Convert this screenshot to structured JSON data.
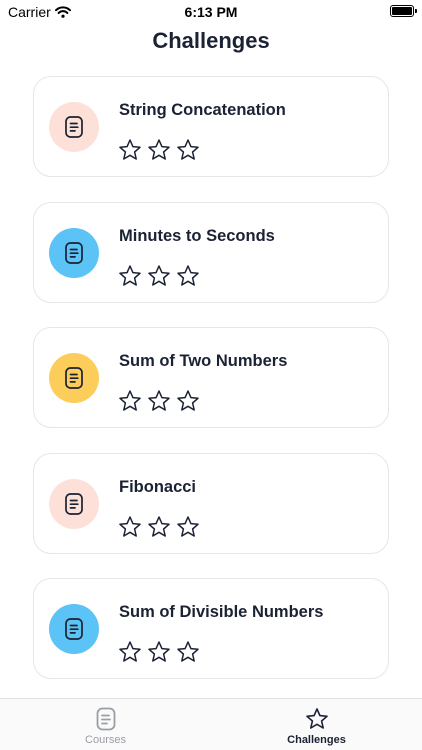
{
  "status_bar": {
    "carrier": "Carrier",
    "time": "6:13 PM",
    "battery_level": 1.0
  },
  "page_title": "Challenges",
  "challenges": [
    {
      "title": "String Concatenation",
      "icon": "document-icon",
      "icon_bg": "#fde0d8",
      "stars_filled": 0,
      "stars_total": 3
    },
    {
      "title": "Minutes to Seconds",
      "icon": "document-icon",
      "icon_bg": "#5bc3f5",
      "stars_filled": 0,
      "stars_total": 3
    },
    {
      "title": "Sum of Two Numbers",
      "icon": "document-icon",
      "icon_bg": "#fccd5a",
      "stars_filled": 0,
      "stars_total": 3
    },
    {
      "title": "Fibonacci",
      "icon": "document-icon",
      "icon_bg": "#fde0d8",
      "stars_filled": 0,
      "stars_total": 3
    },
    {
      "title": "Sum of Divisible Numbers",
      "icon": "document-icon",
      "icon_bg": "#5bc3f5",
      "stars_filled": 0,
      "stars_total": 3
    }
  ],
  "tab_bar": {
    "tabs": [
      {
        "label": "Courses",
        "icon": "document-icon",
        "selected": false
      },
      {
        "label": "Challenges",
        "icon": "star-icon",
        "selected": true
      }
    ]
  },
  "colors": {
    "text": "#1b2233",
    "star_outline": "#1b2233",
    "inactive_tab": "#9a9ea6",
    "card_border": "#e4e6ea"
  }
}
